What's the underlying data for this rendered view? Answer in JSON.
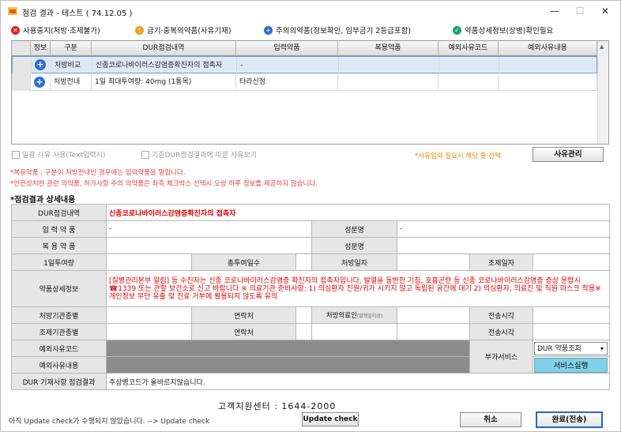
{
  "window": {
    "title": "점검 결과 - 테스트 ( 74.12.05 )",
    "min_label": "—",
    "max_label": "☐",
    "close_label": "✕"
  },
  "legend": [
    {
      "icon": "x-circle-icon",
      "color": "#e02020",
      "glyph": "✕",
      "label": "사용중지(처방·조제불가)"
    },
    {
      "icon": "warning-circle-icon",
      "color": "#f0a020",
      "glyph": "!",
      "label": "금기·중복의약품(사유기재)"
    },
    {
      "icon": "plus-circle-icon",
      "color": "#2f6fd0",
      "glyph": "+",
      "label": "주의의약품(정보확인, 임부금기 2등급포함)"
    },
    {
      "icon": "check-circle-icon",
      "color": "#20a070",
      "glyph": "✓",
      "label": "약품상세정보(상병)확인필요"
    }
  ],
  "grid": {
    "headers": [
      "정보",
      "구분",
      "DUR점검내역",
      "입력약품",
      "복용약품",
      "예외사유코드",
      "예외사유내용"
    ],
    "rows": [
      {
        "type": "처방비교",
        "detail": "신종코로나바이러스감염증확진자의 접촉자",
        "input": "-",
        "taking": "",
        "code": "",
        "reason": ""
      },
      {
        "type": "처방전내",
        "detail": "1일 최대투여량: 40mg (1통목)",
        "input": "타라신정",
        "taking": "",
        "code": "",
        "reason": ""
      }
    ]
  },
  "options": {
    "bulk_reason": "일괄 사유 사용(Text입력시)",
    "prev_reason": "기존DUR점검결과에 따른 사유보기",
    "reason_hint": "*사유입력 필요시 해당 줄 선택",
    "reason_button": "사유관리"
  },
  "notes": {
    "line1": "*복용약품 : 구분이 처방전내인 경우에는 입력약품을 말합니다.",
    "line2": "*안전성처한 관련 의약품, 허가사항 주의 의약품은 좌측 체크박스 선택시 오랑 하루 정보를 제공하지 않습니다."
  },
  "detail": {
    "section_title": "*점검결과 상세내용",
    "dur_label": "DUR점검내역",
    "dur_value": "신종코로나바이러스감염증확진자의 접촉자",
    "input_drug_label": "입 력 약 품",
    "input_drug_value": "-",
    "ingredient_label1": "성분명",
    "ingredient_value1": "-",
    "taking_drug_label": "복 용 약 품",
    "ingredient_label2": "성분명",
    "daily_dose_label": "1일투여량",
    "total_days_label": "총투여일수",
    "rx_date_label": "처방일자",
    "dispense_date_label": "조제일자",
    "drug_info_label": "약품상세정보",
    "drug_info_value": "[질병관리본부 알림] 등 수진자는 신종 코로나바이러스감염증 확진자의 접촉자입니다. 발열을 동반한 기침, 호흡곤란 등 신종 코로나바이러스감염증 증상 문합시 ☎1339 또는 관할 보건소로 신고 바랍니다 ※ 의료기관 준비사항: 1) 의심환자 진원/귀가 시키지 않고 독립된 공간에 대기 2) 의심환자, 의료진 및 직원 마스크 착용※ 개인정보 무단 유출 및 진료 거부에 활용되지 않도록 유의",
    "rx_inst_label": "처방기관종별",
    "contact_label1": "연락처",
    "rx_doctor_label": "처방의료인",
    "rx_doctor_sub": "(발행일이상)",
    "send_time_label1": "전송시각",
    "disp_inst_label": "조제기관종별",
    "contact_label2": "연락처",
    "send_time_label2": "전송시각",
    "exc_code_label": "예외사유코드",
    "exc_reason_label": "예외사유내용",
    "extra_service_label": "부가서비스",
    "service_select": "DUR 약품조회",
    "service_button": "서비스실행",
    "dur_note_label": "DUR 기재사항 점검결과",
    "dur_note_value": "주상병코드가 올바르지않습니다."
  },
  "footer": {
    "support_center": "고객지원센터 : 1644-2000",
    "status": "아직 Update check가 수행되지 않았습니다. --> Update check",
    "update_button": "Update check",
    "cancel_button": "취소",
    "complete_button": "완료(전송)"
  }
}
